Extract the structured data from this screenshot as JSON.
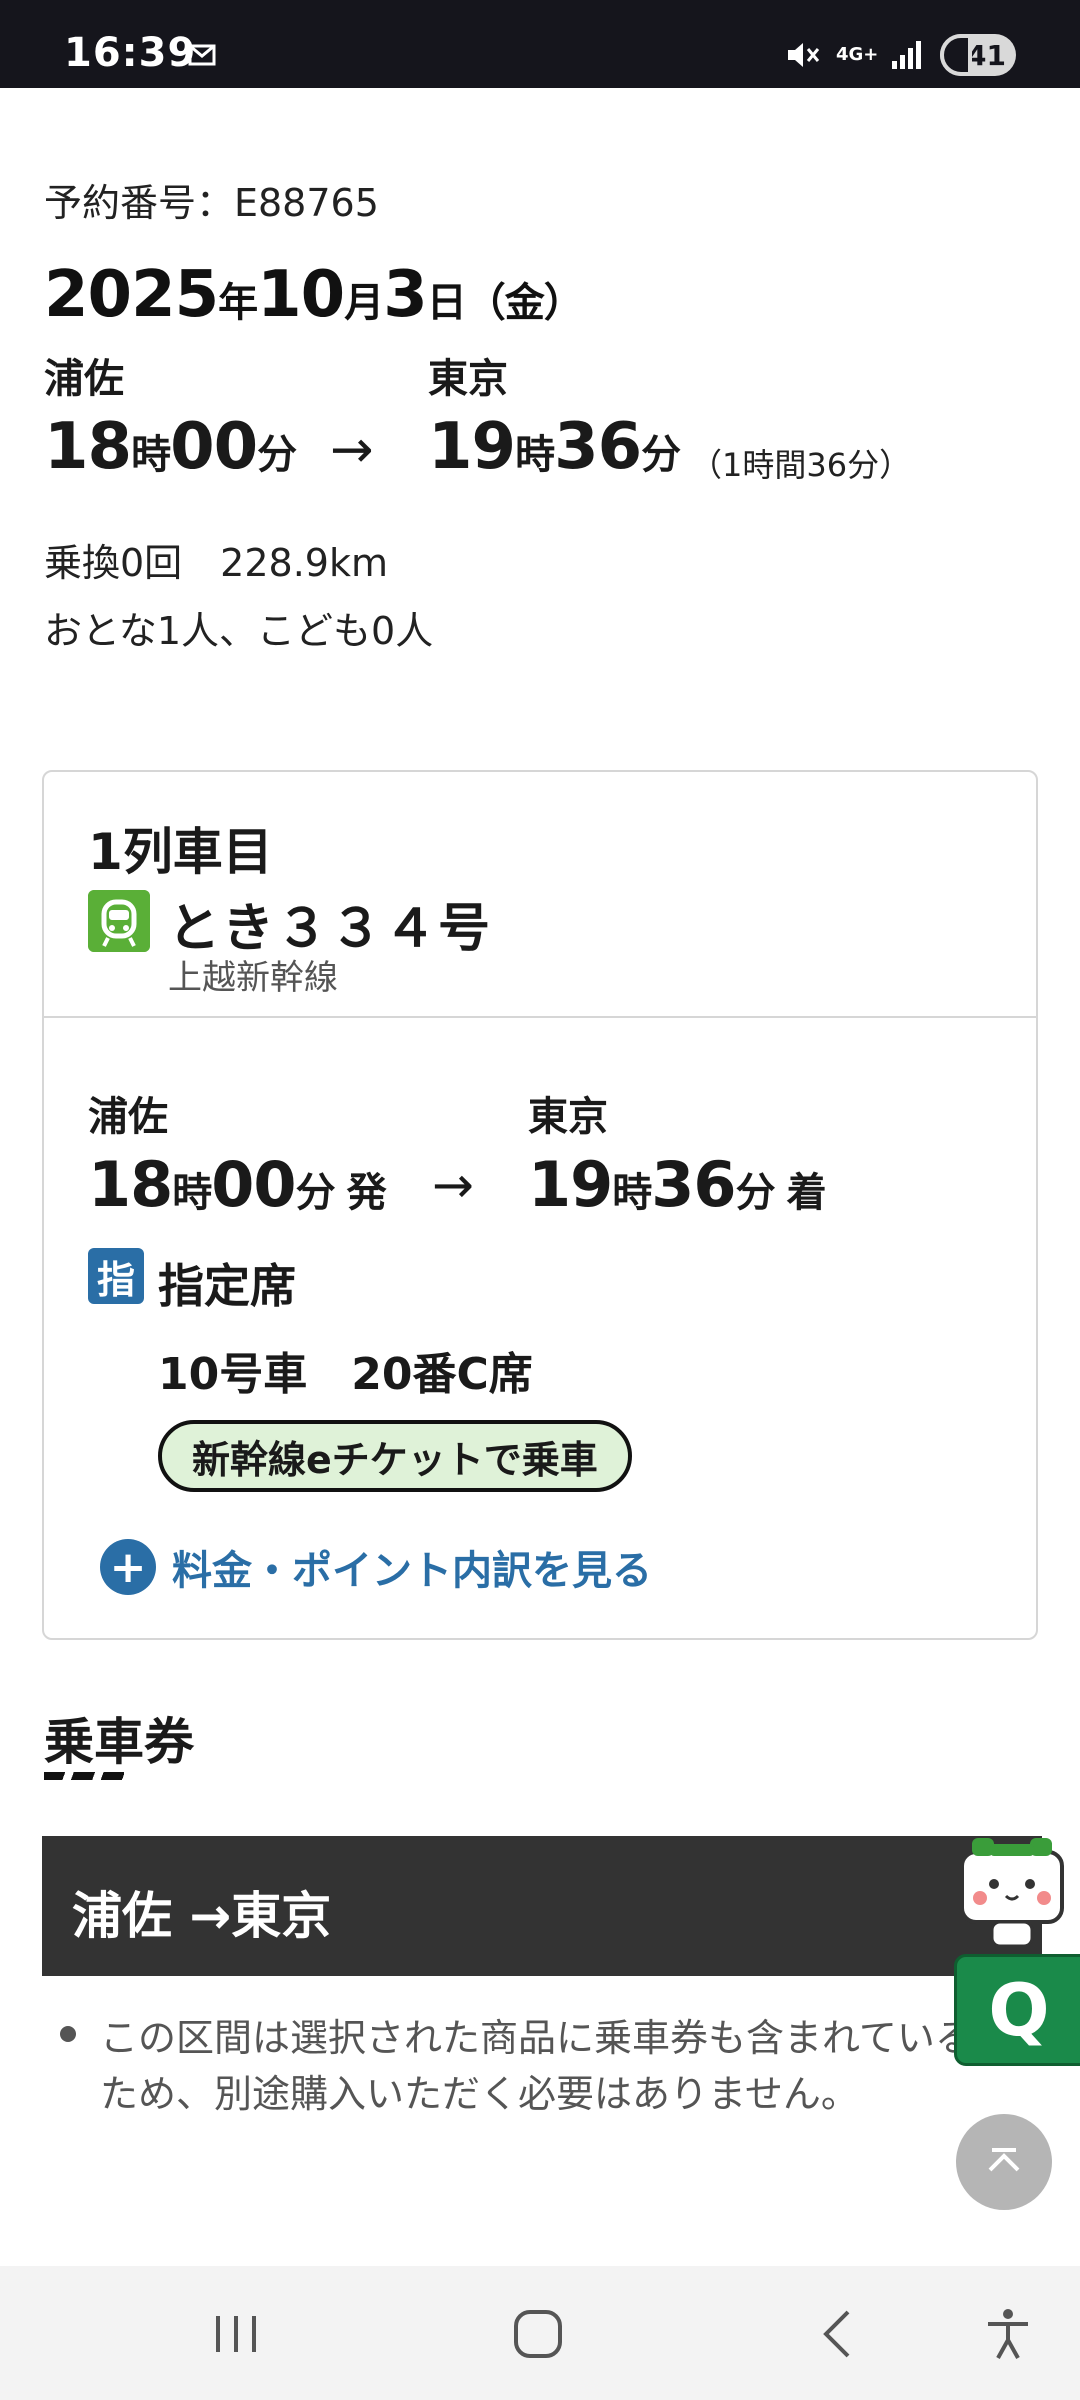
{
  "status_bar": {
    "time": "16:39",
    "network": "4G+",
    "battery": "41",
    "icons": [
      "mail-icon",
      "mute-icon",
      "network-4g-icon",
      "signal-icon",
      "battery-icon"
    ]
  },
  "reservation": {
    "number_label": "予約番号：E88765",
    "date": {
      "year": "2025",
      "year_unit": "年",
      "month": "10",
      "month_unit": "月",
      "day": "3",
      "day_unit": "日",
      "weekday": "（金）"
    },
    "from": "浦佐",
    "to": "東京",
    "depart": {
      "h": "18",
      "h_unit": "時",
      "m": "00",
      "m_unit": "分"
    },
    "arrive": {
      "h": "19",
      "h_unit": "時",
      "m": "36",
      "m_unit": "分"
    },
    "arrow": "→",
    "duration": "（1時間36分）",
    "transfer": "乗換0回　228.9km",
    "people": "おとな1人、こども0人"
  },
  "train_card": {
    "title": "1列車目",
    "train_name": "とき３３４号",
    "line": "上越新幹線",
    "from": "浦佐",
    "to": "東京",
    "depart": {
      "h": "18",
      "h_unit": "時",
      "m": "00",
      "m_unit": "分",
      "suffix": "発"
    },
    "arrive": {
      "h": "19",
      "h_unit": "時",
      "m": "36",
      "m_unit": "分",
      "suffix": "着"
    },
    "arrow": "→",
    "seat_badge": "指",
    "seat_type": "指定席",
    "seat_no": "10号車　20番C席",
    "eticket": "新幹線eチケットで乗車",
    "breakdown_link": "料金・ポイント内訳を見る",
    "plus": "+"
  },
  "ticket_section": {
    "title": "乗車券",
    "route": "浦佐 →東京",
    "note": "この区間は選択された商品に乗車券も含まれているため、別途購入いただく必要はありません。"
  },
  "floating": {
    "q_label": "Q"
  },
  "colors": {
    "train_green": "#5aaf37",
    "seat_blue": "#2a6ea6",
    "eticket_bg": "#dff2d8",
    "route_bar": "#333333",
    "q_green": "#1a8a4a"
  }
}
